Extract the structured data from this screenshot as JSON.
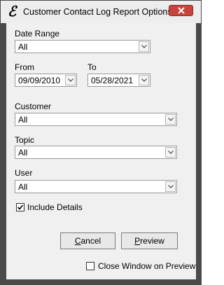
{
  "window": {
    "title": "Customer Contact Log Report Options"
  },
  "date_range": {
    "label": "Date Range",
    "value": "All"
  },
  "from": {
    "label": "From",
    "value": "09/09/2010"
  },
  "to": {
    "label": "To",
    "value": "05/28/2021"
  },
  "customer": {
    "label": "Customer",
    "value": "All"
  },
  "topic": {
    "label": "Topic",
    "value": "All"
  },
  "user": {
    "label": "User",
    "value": "All"
  },
  "include_details": {
    "label": "Include Details",
    "checked": true
  },
  "buttons": {
    "cancel_first": "C",
    "cancel_rest": "ancel",
    "preview_first": "P",
    "preview_rest": "review"
  },
  "close_on_preview": {
    "label": "Close Window on Preview",
    "checked": false
  }
}
